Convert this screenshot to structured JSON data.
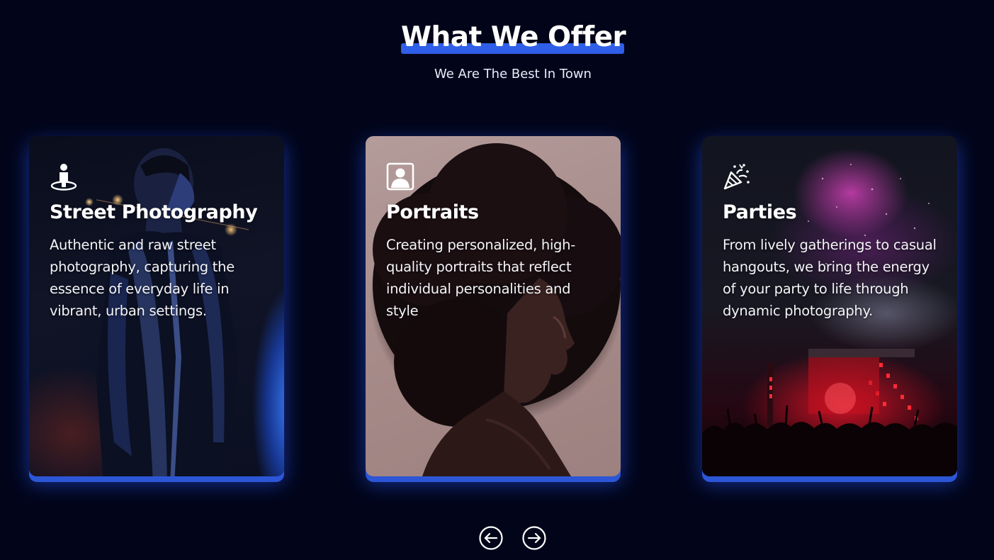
{
  "header": {
    "title": "What We Offer",
    "subtitle": "We Are The Best In Town"
  },
  "cards": [
    {
      "title": "Street Photography",
      "text": "Authentic and raw street photography, capturing the essence of everyday life in vibrant, urban settings.",
      "icon": "person-location-icon"
    },
    {
      "title": "Portraits",
      "text": "Creating personalized, high-quality portraits that reflect individual personalities and style",
      "icon": "portrait-frame-icon"
    },
    {
      "title": "Parties",
      "text": "From lively gatherings to casual hangouts, we bring the energy of your party to life through dynamic photography.",
      "icon": "party-popper-icon"
    }
  ],
  "navigation": {
    "prev_icon": "arrow-left-circle-icon",
    "next_icon": "arrow-right-circle-icon"
  },
  "colors": {
    "background": "#02051a",
    "accent": "#2f5fe8",
    "text": "#ffffff"
  }
}
